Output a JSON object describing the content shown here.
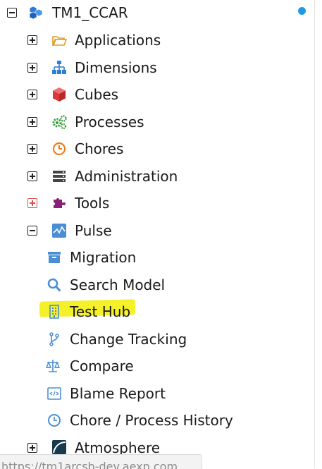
{
  "tree": {
    "root": {
      "label": "TM1_CCAR",
      "icon": "server-cubes-icon"
    },
    "items": [
      {
        "label": "Applications",
        "icon": "folder-icon"
      },
      {
        "label": "Dimensions",
        "icon": "hierarchy-icon"
      },
      {
        "label": "Cubes",
        "icon": "cube-icon"
      },
      {
        "label": "Processes",
        "icon": "gears-icon"
      },
      {
        "label": "Chores",
        "icon": "clock-icon"
      },
      {
        "label": "Administration",
        "icon": "server-rack-icon"
      },
      {
        "label": "Tools",
        "icon": "puzzle-icon"
      },
      {
        "label": "Pulse",
        "icon": "pulse-icon"
      }
    ],
    "pulse_children": [
      {
        "label": "Migration",
        "icon": "archive-box-icon"
      },
      {
        "label": "Search Model",
        "icon": "magnifier-icon"
      },
      {
        "label": "Test Hub",
        "icon": "building-icon"
      },
      {
        "label": "Change Tracking",
        "icon": "branch-icon"
      },
      {
        "label": "Compare",
        "icon": "scales-icon"
      },
      {
        "label": "Blame Report",
        "icon": "code-doc-icon"
      },
      {
        "label": "Chore / Process History",
        "icon": "history-clock-icon"
      }
    ],
    "atmosphere": {
      "label": "Atmosphere",
      "icon": "atmosphere-icon"
    }
  },
  "status_bar": {
    "url": "https://tm1arcsb-dev.aexp.com"
  },
  "colors": {
    "highlight": "#f4f02a",
    "status_dot": "#1f9ae6",
    "accent_blue": "#4a8fd6"
  }
}
